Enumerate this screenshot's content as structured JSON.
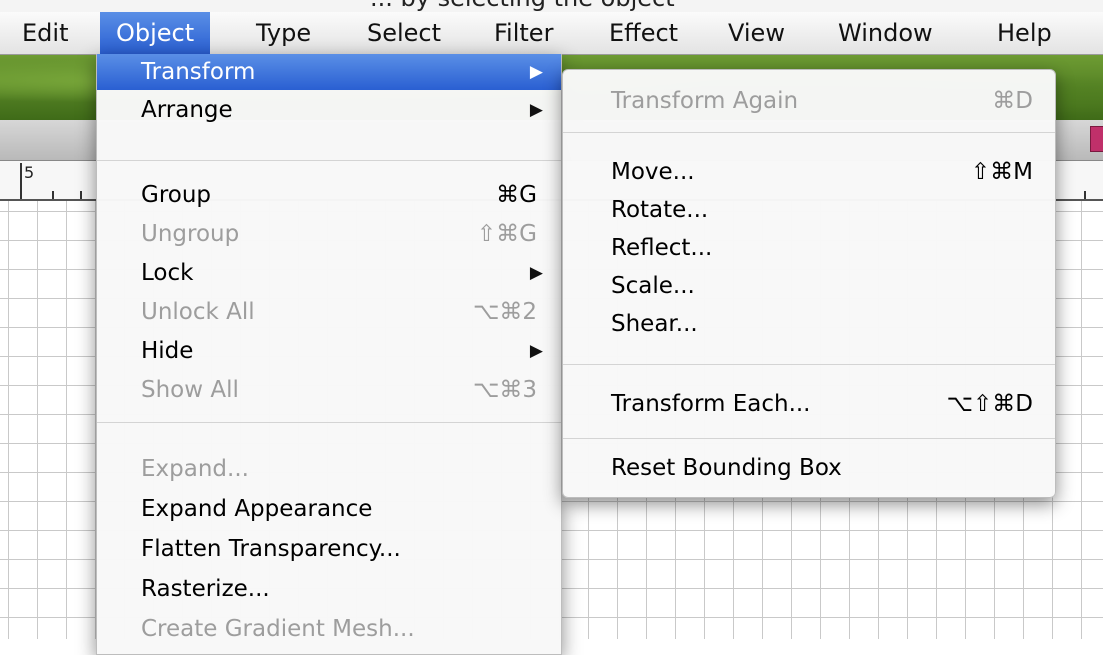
{
  "top_strip_text": "... by selecting the object",
  "menubar": {
    "items": [
      "Edit",
      "Object",
      "Type",
      "Select",
      "Filter",
      "Effect",
      "View",
      "Window",
      "Help"
    ],
    "active": "Object"
  },
  "ruler": {
    "label": "5"
  },
  "object_menu": {
    "items": [
      {
        "label": "Transform",
        "shortcut": "",
        "submenu": true,
        "disabled": false,
        "highlighted": true
      },
      {
        "label": "Arrange",
        "shortcut": "",
        "submenu": true,
        "disabled": false
      },
      {
        "label": "Group",
        "shortcut": "⌘G",
        "submenu": false,
        "disabled": false
      },
      {
        "label": "Ungroup",
        "shortcut": "⇧⌘G",
        "submenu": false,
        "disabled": true
      },
      {
        "label": "Lock",
        "shortcut": "",
        "submenu": true,
        "disabled": false
      },
      {
        "label": "Unlock All",
        "shortcut": "⌥⌘2",
        "submenu": false,
        "disabled": true
      },
      {
        "label": "Hide",
        "shortcut": "",
        "submenu": true,
        "disabled": false
      },
      {
        "label": "Show All",
        "shortcut": "⌥⌘3",
        "submenu": false,
        "disabled": true
      },
      {
        "label": "Expand...",
        "shortcut": "",
        "submenu": false,
        "disabled": true
      },
      {
        "label": "Expand Appearance",
        "shortcut": "",
        "submenu": false,
        "disabled": false
      },
      {
        "label": "Flatten Transparency...",
        "shortcut": "",
        "submenu": false,
        "disabled": false
      },
      {
        "label": "Rasterize...",
        "shortcut": "",
        "submenu": false,
        "disabled": false
      },
      {
        "label": "Create Gradient Mesh...",
        "shortcut": "",
        "submenu": false,
        "disabled": true
      }
    ]
  },
  "transform_submenu": {
    "items": [
      {
        "label": "Transform Again",
        "shortcut": "⌘D",
        "disabled": true
      },
      {
        "label": "Move...",
        "shortcut": "⇧⌘M",
        "disabled": false
      },
      {
        "label": "Rotate...",
        "shortcut": "",
        "disabled": false
      },
      {
        "label": "Reflect...",
        "shortcut": "",
        "disabled": false
      },
      {
        "label": "Scale...",
        "shortcut": "",
        "disabled": false
      },
      {
        "label": "Shear...",
        "shortcut": "",
        "disabled": false
      },
      {
        "label": "Transform Each...",
        "shortcut": "⌥⇧⌘D",
        "disabled": false
      },
      {
        "label": "Reset Bounding Box",
        "shortcut": "",
        "disabled": false
      }
    ]
  },
  "icons": {
    "submenu_arrow": "submenu-arrow-icon",
    "arrow_glyph": "▶"
  },
  "colors": {
    "highlight": "#2a5fd2",
    "disabled_text": "#9d9d9d"
  }
}
